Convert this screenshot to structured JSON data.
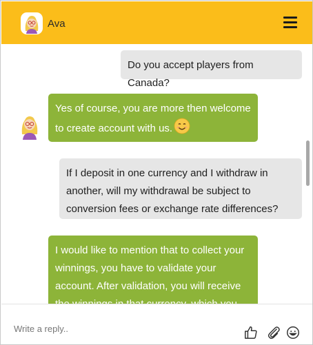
{
  "theme": {
    "accent": "#fbbd1a",
    "agent_bubble": "#8db439",
    "user_bubble": "#e6e6e6"
  },
  "header": {
    "agent_name": "Ava",
    "avatar_icon": "female-agent-avatar-icon",
    "menu_icon": "hamburger-menu-icon"
  },
  "messages": [
    {
      "from": "user",
      "text": "Do you accept players from Canada?"
    },
    {
      "from": "agent",
      "lines": [
        "Yes of course, you are more then welcome",
        "to create account with us."
      ],
      "emoji": "smiling-face-icon"
    },
    {
      "from": "user",
      "lines": [
        "If I deposit in one currency and I withdraw in",
        "another, will my withdrawal be subject to",
        "conversion fees or exchange rate differences?"
      ]
    },
    {
      "from": "agent",
      "lines": [
        "I would like to mention that to collect your",
        "winnings, you have to validate your",
        "account. After validation, you will receive",
        "the winnings in that currency, which you"
      ]
    }
  ],
  "composer": {
    "placeholder": "Write a reply..",
    "icons": [
      "thumbs-up-icon",
      "paperclip-icon",
      "emoji-icon"
    ]
  }
}
